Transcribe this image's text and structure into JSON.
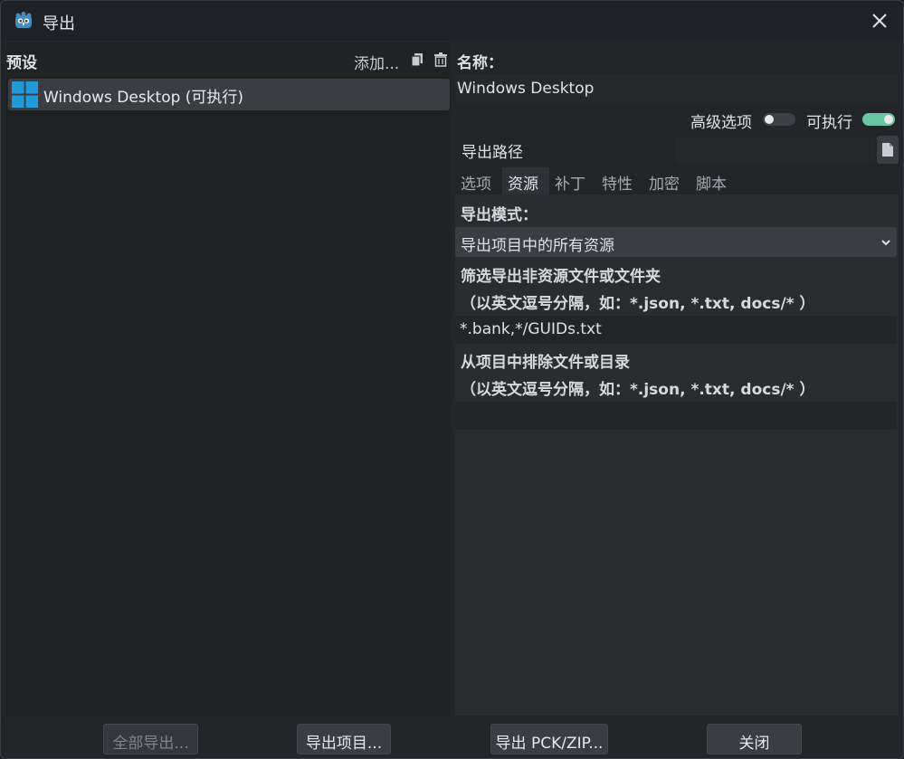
{
  "window": {
    "title": "导出"
  },
  "presets": {
    "header": "预设",
    "add_label": "添加...",
    "items": [
      {
        "label": "Windows Desktop (可执行)"
      }
    ]
  },
  "details": {
    "name_label": "名称：",
    "name_value": "Windows Desktop",
    "advanced_label": "高级选项",
    "advanced_on": false,
    "executable_label": "可执行",
    "executable_on": true,
    "export_path_label": "导出路径",
    "export_path_value": ""
  },
  "tabs": [
    {
      "label": "选项"
    },
    {
      "label": "资源"
    },
    {
      "label": "补丁"
    },
    {
      "label": "特性"
    },
    {
      "label": "加密"
    },
    {
      "label": "脚本"
    }
  ],
  "active_tab": "资源",
  "resources": {
    "export_mode_label": "导出模式：",
    "export_mode_value": "导出项目中的所有资源",
    "include_filter_label": "筛选导出非资源文件或文件夹",
    "include_filter_hint": "（以英文逗号分隔，如：*.json, *.txt, docs/* ）",
    "include_filter_value": "*.bank,*/GUIDs.txt",
    "exclude_filter_label": "从项目中排除文件或目录",
    "exclude_filter_hint": "（以英文逗号分隔，如：*.json, *.txt, docs/* ）",
    "exclude_filter_value": ""
  },
  "footer": {
    "export_all": "全部导出...",
    "export_project": "导出项目...",
    "export_pck": "导出 PCK/ZIP...",
    "close": "关闭"
  },
  "colors": {
    "accent": "#67c5a0",
    "windows_blue": "#1e9bdb",
    "godot_blue": "#478cbf"
  }
}
